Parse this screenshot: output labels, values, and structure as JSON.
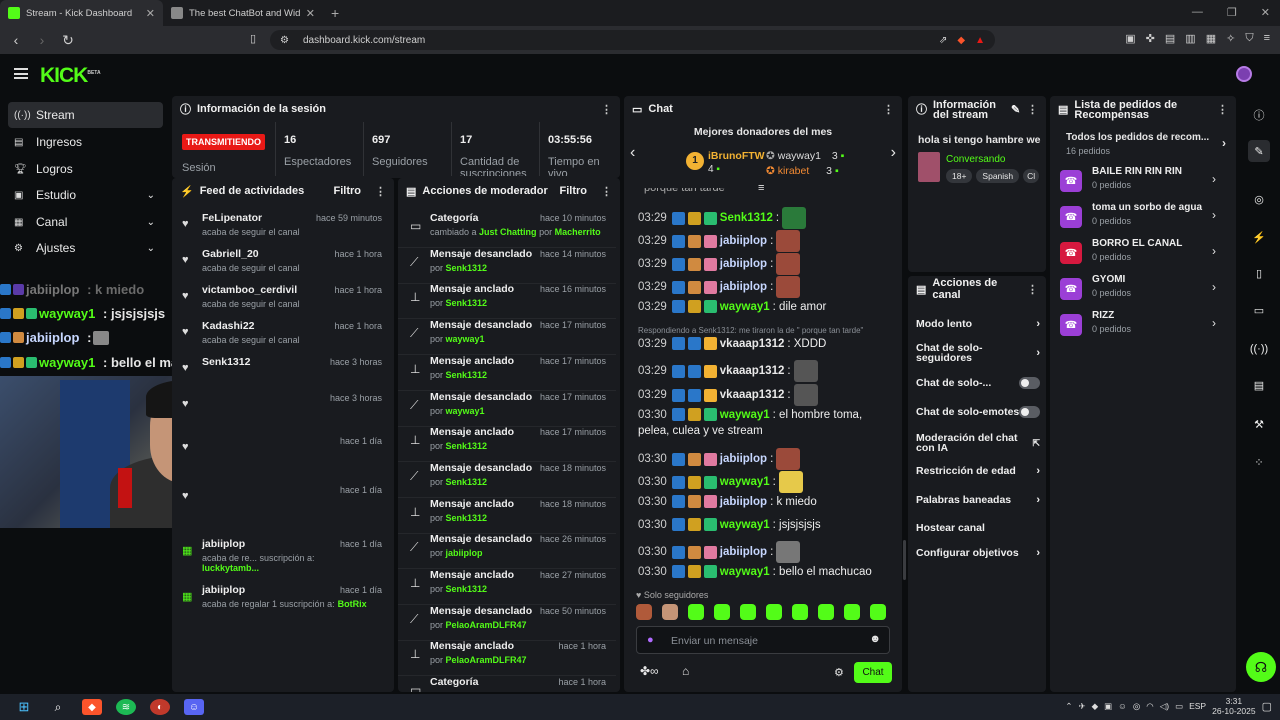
{
  "browser": {
    "tabs": [
      {
        "title": "Stream - Kick Dashboard",
        "active": true
      },
      {
        "title": "The best ChatBot and Widgets for Ki",
        "active": false
      }
    ],
    "url": "dashboard.kick.com/stream"
  },
  "header": {
    "logo": "KICK",
    "logo_sup": "BETA"
  },
  "sidebar": {
    "items": [
      {
        "label": "Stream",
        "icon": "stream-icon"
      },
      {
        "label": "Ingresos",
        "icon": "revenue-icon"
      },
      {
        "label": "Logros",
        "icon": "trophy-icon"
      },
      {
        "label": "Estudio",
        "icon": "studio-icon"
      },
      {
        "label": "Canal",
        "icon": "channel-icon"
      },
      {
        "label": "Ajustes",
        "icon": "gear-icon"
      }
    ]
  },
  "overlay_chat": [
    {
      "user": "jabiiplop",
      "text": ": k miedo"
    },
    {
      "user": "wayway1",
      "text": ": jsjsjsjsjs"
    },
    {
      "user": "jabiiplop",
      "text": ":"
    },
    {
      "user": "wayway1",
      "text": ": bello el machucao"
    }
  ],
  "session": {
    "title": "Información de la sesión",
    "live": "TRANSMITIENDO",
    "label_session": "Sesión",
    "stats": [
      {
        "value": "16",
        "label": "Espectadores"
      },
      {
        "value": "697",
        "label": "Seguidores"
      },
      {
        "value": "17",
        "label": "Cantidad de suscripciones"
      },
      {
        "value": "03:55:56",
        "label": "Tiempo en vivo"
      }
    ]
  },
  "feed": {
    "title": "Feed de actividades",
    "filter": "Filtro",
    "items": [
      {
        "name": "FeLipenator",
        "time": "hace 59 minutos",
        "desc": "acaba de seguir el canal",
        "type": "follow"
      },
      {
        "name": "Gabriell_20",
        "time": "hace 1 hora",
        "desc": "acaba de seguir el canal",
        "type": "follow"
      },
      {
        "name": "victamboo_cerdivil",
        "time": "hace 1 hora",
        "desc": "acaba de seguir el canal",
        "type": "follow"
      },
      {
        "name": "Kadashi22",
        "time": "hace 1 hora",
        "desc": "acaba de seguir el canal",
        "type": "follow"
      },
      {
        "name": "Senk1312",
        "time": "hace 3 horas",
        "desc": "",
        "type": "follow"
      },
      {
        "name": "",
        "time": "hace 3 horas",
        "desc": "",
        "type": "follow"
      },
      {
        "name": "",
        "time": "hace 1 día",
        "desc": "",
        "type": "follow"
      },
      {
        "name": "",
        "time": "hace 1 día",
        "desc": "",
        "type": "follow"
      },
      {
        "name": "jabiiplop",
        "time": "hace 1 día",
        "desc": "acaba de re... suscripción a:",
        "user2": "luckkytamb...",
        "type": "gift"
      },
      {
        "name": "jabiiplop",
        "time": "hace 1 día",
        "desc": "acaba de regalar 1 suscripción a:",
        "user2": "BotRix",
        "type": "gift"
      }
    ]
  },
  "mod": {
    "title": "Acciones de moderador",
    "filter": "Filtro",
    "items": [
      {
        "action": "Categoría",
        "time": "hace 10 minutos",
        "desc": "cambiado a",
        "cat": "Just Chatting",
        "by": "por",
        "user": "Macherrito",
        "icon": "category-icon"
      },
      {
        "action": "Mensaje desanclado",
        "time": "hace 14 minutos",
        "by": "por",
        "user": "Senk1312",
        "icon": "unpin-icon"
      },
      {
        "action": "Mensaje anclado",
        "time": "hace 16 minutos",
        "by": "por",
        "user": "Senk1312",
        "icon": "pin-icon"
      },
      {
        "action": "Mensaje desanclado",
        "time": "hace 17 minutos",
        "by": "por",
        "user": "wayway1",
        "icon": "unpin-icon"
      },
      {
        "action": "Mensaje anclado",
        "time": "hace 17 minutos",
        "by": "por",
        "user": "Senk1312",
        "icon": "pin-icon"
      },
      {
        "action": "Mensaje desanclado",
        "time": "hace 17 minutos",
        "by": "por",
        "user": "wayway1",
        "icon": "unpin-icon"
      },
      {
        "action": "Mensaje anclado",
        "time": "hace 17 minutos",
        "by": "por",
        "user": "Senk1312",
        "icon": "pin-icon"
      },
      {
        "action": "Mensaje desanclado",
        "time": "hace 18 minutos",
        "by": "por",
        "user": "Senk1312",
        "icon": "unpin-icon"
      },
      {
        "action": "Mensaje anclado",
        "time": "hace 18 minutos",
        "by": "por",
        "user": "Senk1312",
        "icon": "pin-icon"
      },
      {
        "action": "Mensaje desanclado",
        "time": "hace 26 minutos",
        "by": "por",
        "user": "jabiiplop",
        "icon": "unpin-icon"
      },
      {
        "action": "Mensaje anclado",
        "time": "hace 27 minutos",
        "by": "por",
        "user": "Senk1312",
        "icon": "pin-icon"
      },
      {
        "action": "Mensaje desanclado",
        "time": "hace 50 minutos",
        "by": "por",
        "user": "PelaoAramDLFR47",
        "icon": "unpin-icon"
      },
      {
        "action": "Mensaje anclado",
        "time": "hace 1 hora",
        "by": "por",
        "user": "PelaoAramDLFR47",
        "icon": "pin-icon"
      },
      {
        "action": "Categoría",
        "time": "hace 1 hora",
        "icon": "category-icon"
      }
    ]
  },
  "chat": {
    "title": "Chat",
    "donors_title": "Mejores donadores del mes",
    "donors": [
      {
        "rank": "1",
        "name": "iBrunoFTW",
        "value": "4"
      },
      {
        "name": "wayway1",
        "value": "3"
      },
      {
        "name": "kirabet",
        "value": "3"
      }
    ],
    "partial_top": "porque tan tarde",
    "reply_note": "Respondiendo a Senk1312: me tiraron la de \" porque tan tarde\"",
    "messages": [
      {
        "time": "03:29",
        "user": "Senk1312",
        "text": ":",
        "color": "g",
        "emote": true
      },
      {
        "time": "03:29",
        "user": "jabiiplop",
        "text": ":",
        "color": "b",
        "emote": true
      },
      {
        "time": "03:29",
        "user": "jabiiplop",
        "text": ":",
        "color": "b",
        "emote": true
      },
      {
        "time": "03:29",
        "user": "jabiiplop",
        "text": ":",
        "color": "b",
        "emote": true
      },
      {
        "time": "03:29",
        "user": "wayway1",
        "text": ": dile amor",
        "color": "g"
      },
      {
        "time": "03:29",
        "user": "vkaaap1312",
        "text": ": XDDD",
        "color": "l"
      },
      {
        "time": "03:29",
        "user": "vkaaap1312",
        "text": ":",
        "color": "l",
        "emote": true
      },
      {
        "time": "03:29",
        "user": "vkaaap1312",
        "text": ":",
        "color": "l",
        "emote": true
      },
      {
        "time": "03:30",
        "user": "wayway1",
        "text": ": el hombre toma,",
        "cont": "pelea, culea y ve stream",
        "color": "g"
      },
      {
        "time": "03:30",
        "user": "jabiiplop",
        "text": ":",
        "color": "b",
        "emote": true
      },
      {
        "time": "03:30",
        "user": "wayway1",
        "text": ":",
        "color": "g",
        "emote": true
      },
      {
        "time": "03:30",
        "user": "jabiiplop",
        "text": ": k miedo",
        "color": "b"
      },
      {
        "time": "03:30",
        "user": "wayway1",
        "text": ": jsjsjsjsjs",
        "color": "g"
      },
      {
        "time": "03:30",
        "user": "jabiiplop",
        "text": ":",
        "color": "b",
        "emote": true
      },
      {
        "time": "03:30",
        "user": "wayway1",
        "text": ": bello el machucao",
        "color": "g"
      }
    ],
    "followers_only": "Solo seguidores",
    "placeholder": "Enviar un mensaje",
    "send": "Chat"
  },
  "stream_info": {
    "title": "Información del stream",
    "stream_title": "hola si tengo hambre we",
    "category": "Conversando",
    "tags": [
      "18+",
      "Spanish",
      "Cl"
    ]
  },
  "channel_actions": {
    "title": "Acciones de canal",
    "items": [
      {
        "label": "Modo lento",
        "kind": "chev"
      },
      {
        "label": "Chat de solo-seguidores",
        "kind": "chev"
      },
      {
        "label": "Chat de solo-...",
        "kind": "toggle"
      },
      {
        "label": "Chat de solo-emotes",
        "kind": "toggle"
      },
      {
        "label": "Moderación del chat con IA",
        "kind": "ext"
      },
      {
        "label": "Restricción de edad",
        "kind": "chev"
      },
      {
        "label": "Palabras baneadas",
        "kind": "chev"
      },
      {
        "label": "Hostear canal",
        "kind": "none"
      },
      {
        "label": "Configurar objetivos",
        "kind": "chev"
      }
    ]
  },
  "rewards": {
    "title": "Lista de pedidos de Recompensas",
    "all": "Todos los pedidos de recom...",
    "all_count": "16 pedidos",
    "items": [
      {
        "name": "BAILE RIN RIN RIN",
        "count": "0 pedidos",
        "color": "#9b3fd6"
      },
      {
        "name": "toma un sorbo de agua",
        "count": "0 pedidos",
        "color": "#9b3fd6"
      },
      {
        "name": "BORRO EL CANAL",
        "count": "0 pedidos",
        "color": "#d6193f"
      },
      {
        "name": "GYOMI",
        "count": "0 pedidos",
        "color": "#9b3fd6"
      },
      {
        "name": "RIZZ",
        "count": "0 pedidos",
        "color": "#9b3fd6"
      }
    ]
  },
  "taskbar": {
    "lang": "ESP",
    "time": "3:31",
    "date": "26-10-2025"
  },
  "colors": {
    "accent": "#53fc18",
    "live": "#e91916",
    "panel": "#191b1f"
  }
}
